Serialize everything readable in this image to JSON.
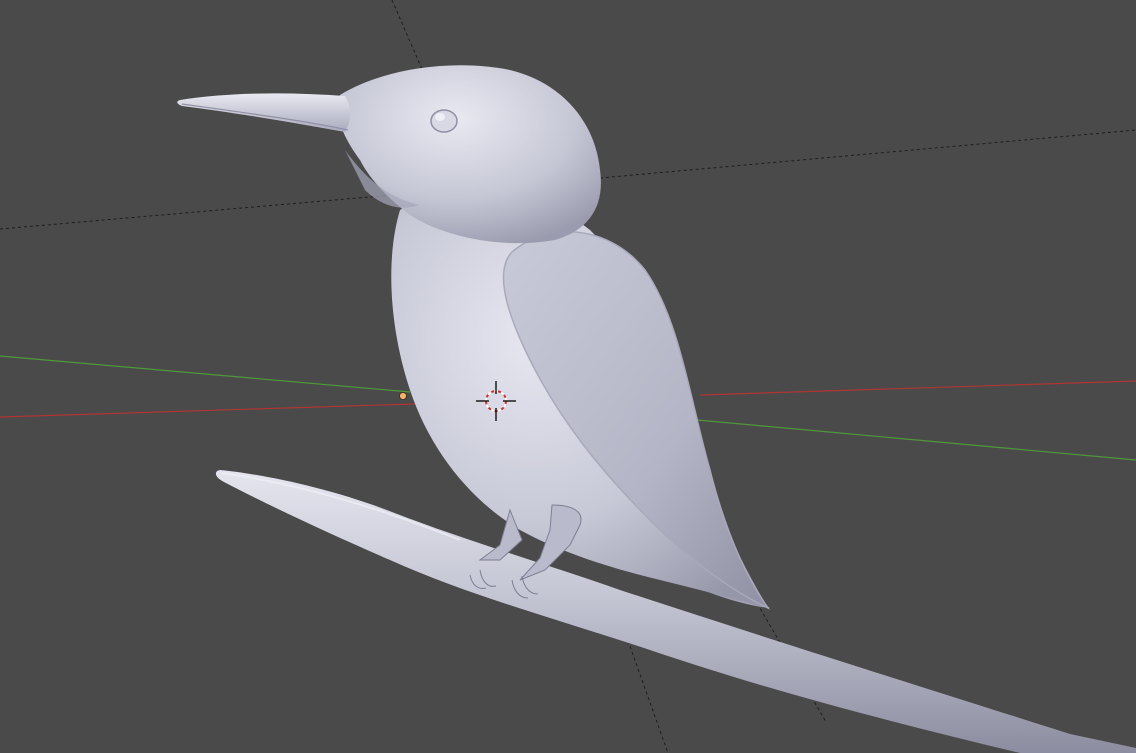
{
  "app": {
    "editor": "3D Viewport",
    "shading": "solid",
    "subject": "kingfisher-on-branch-sculpt"
  },
  "colors": {
    "background": "#4a4a4a",
    "axis_x": "#b03535",
    "axis_y": "#4f9a3a",
    "dashed_line": "#1e1e1e",
    "model_clay": "#c9cad8",
    "model_shadow": "#8f90a3",
    "cursor_ring_red": "#d23030",
    "cursor_ring_white": "#ffffff",
    "origin_dot": "#f2b46a"
  },
  "icons": {
    "cursor": "3d-cursor-icon",
    "origin": "object-origin-icon"
  }
}
